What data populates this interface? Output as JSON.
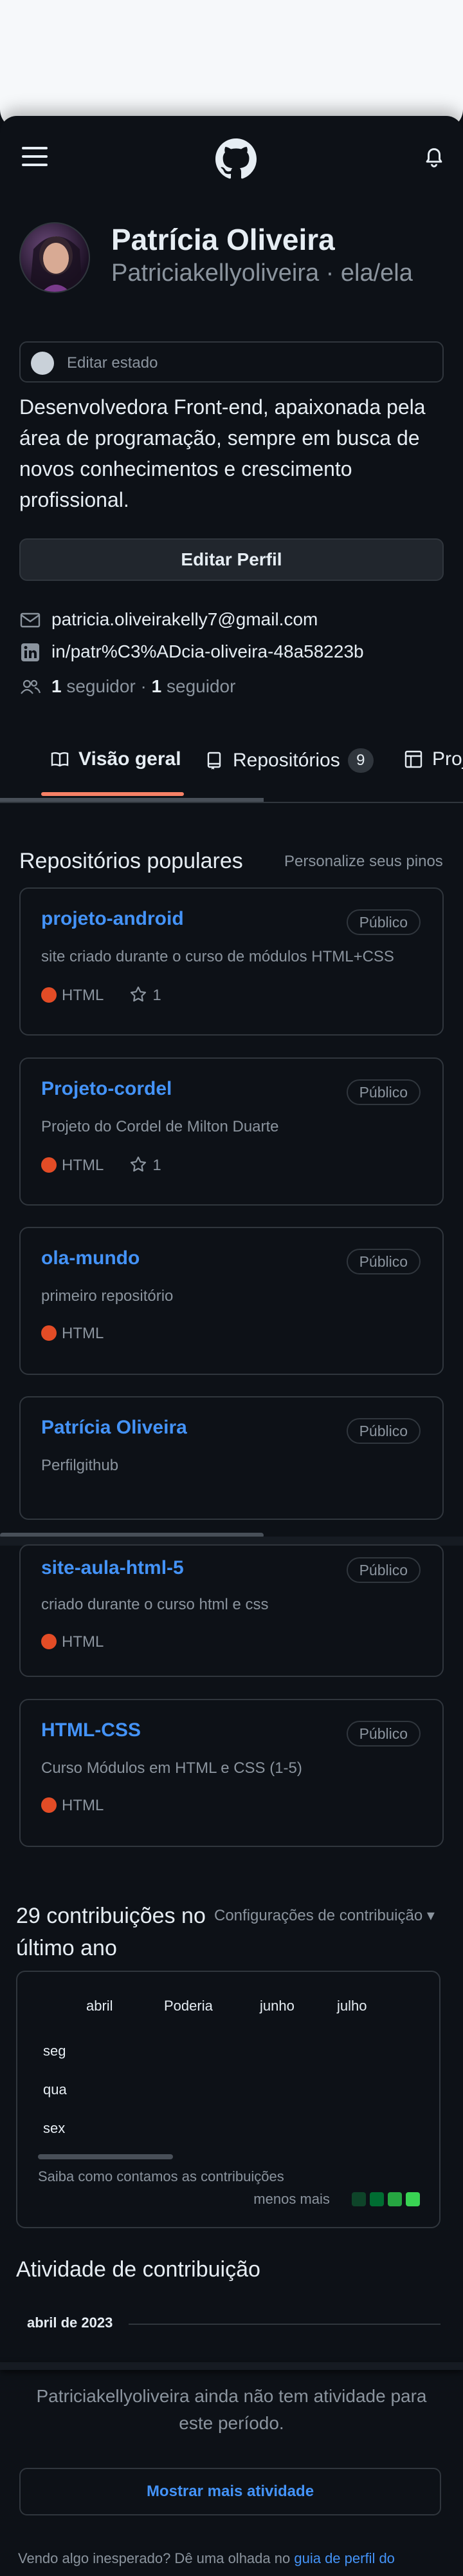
{
  "profile": {
    "name": "Patrícia Oliveira",
    "login_line": "Patriciakellyoliveira · ela/ela",
    "status_placeholder": "Editar estado",
    "bio": "Desenvolvedora Front-end, apaixonada pela área de programação, sempre em busca de novos conhecimentos e crescimento profissional.",
    "edit_button": "Editar Perfil",
    "email": "patricia.oliveirakelly7@gmail.com",
    "linkedin": "in/patr%C3%ADcia-oliveira-48a58223b",
    "followers_count": "1",
    "followers_label": "seguidor",
    "following_sep": "·",
    "following_count": "1",
    "following_label": "seguidor"
  },
  "tabs": [
    {
      "label": "Visão geral",
      "icon": "book-icon",
      "active": true
    },
    {
      "label": "Repositórios",
      "count": "9",
      "icon": "repo-icon"
    },
    {
      "label": "Proj",
      "icon": "table-icon"
    }
  ],
  "popular": {
    "title": "Repositórios populares",
    "customize": "Personalize seus pinos"
  },
  "repos": [
    {
      "name": "projeto-android",
      "badge": "Público",
      "desc": "site criado durante o curso de módulos HTML+CSS",
      "lang": "HTML",
      "stars": "1"
    },
    {
      "name": "Projeto-cordel",
      "badge": "Público",
      "desc": "Projeto do Cordel de Milton Duarte",
      "lang": "HTML",
      "stars": "1"
    },
    {
      "name": "ola-mundo",
      "badge": "Público",
      "desc": "primeiro repositório",
      "lang": "HTML"
    },
    {
      "name": "Patrícia Oliveira",
      "badge": "Público",
      "desc": "Perfilgithub"
    },
    {
      "name": "site-aula-html-5",
      "badge": "Público",
      "desc": "criado durante o curso html e css",
      "lang": "HTML"
    },
    {
      "name": "HTML-CSS",
      "badge": "Público",
      "desc": "Curso Módulos em HTML e CSS (1-5)",
      "lang": "HTML"
    }
  ],
  "contributions": {
    "title": "29 contribuições no último ano",
    "settings": "Configurações de contribuição",
    "months": [
      "abril",
      "Poderia",
      "junho",
      "julho"
    ],
    "days": [
      "seg",
      "qua",
      "sex"
    ],
    "learn": "Saiba como contamos as contribuições",
    "legend_label": "menos mais",
    "legend_colors": [
      "#0e4429",
      "#006d32",
      "#26a641",
      "#39d353"
    ]
  },
  "activity": {
    "title": "Atividade de contribuição",
    "month": "abril de 2023",
    "empty": "Patriciakellyoliveira ainda não tem atividade para este período.",
    "show_more": "Mostrar mais atividade",
    "footer_prefix": "Vendo algo inesperado? Dê uma olhada no",
    "footer_link": "guia de perfil do"
  },
  "colors": {
    "background": "#0d1117",
    "link": "#4493f8",
    "html_lang": "#e34c26",
    "tab_underline": "#f78166"
  }
}
